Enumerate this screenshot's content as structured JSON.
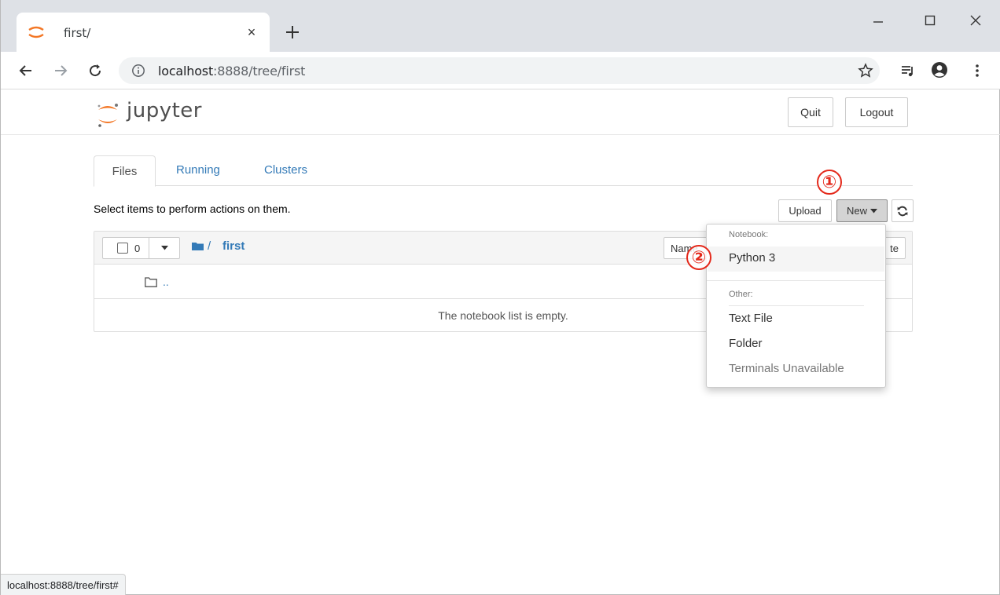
{
  "browser": {
    "tab_title": "first/",
    "tab_close": "×",
    "url_host": "localhost",
    "url_path": ":8888/tree/first",
    "status_url": "localhost:8888/tree/first#"
  },
  "jupyter": {
    "logo_text": "jupyter",
    "quit_label": "Quit",
    "logout_label": "Logout",
    "tabs": [
      {
        "label": "Files",
        "active": true
      },
      {
        "label": "Running",
        "active": false
      },
      {
        "label": "Clusters",
        "active": false
      }
    ],
    "select_text": "Select items to perform actions on them.",
    "upload_label": "Upload",
    "new_label": "New",
    "selected_count": "0",
    "breadcrumb_sep": "/",
    "breadcrumb_folder": "first",
    "sort_name_label": "Name",
    "sort_partial_label": "te",
    "parent_dir": "..",
    "empty_message": "The notebook list is empty."
  },
  "new_menu": {
    "notebook_header": "Notebook:",
    "python3": "Python 3",
    "other_header": "Other:",
    "text_file": "Text File",
    "folder": "Folder",
    "terminals": "Terminals Unavailable"
  },
  "annotations": {
    "marker1": "①",
    "marker2": "②",
    "color": "#e4291b"
  },
  "colors": {
    "link": "#337ab7",
    "jupyter_orange": "#f37726"
  }
}
